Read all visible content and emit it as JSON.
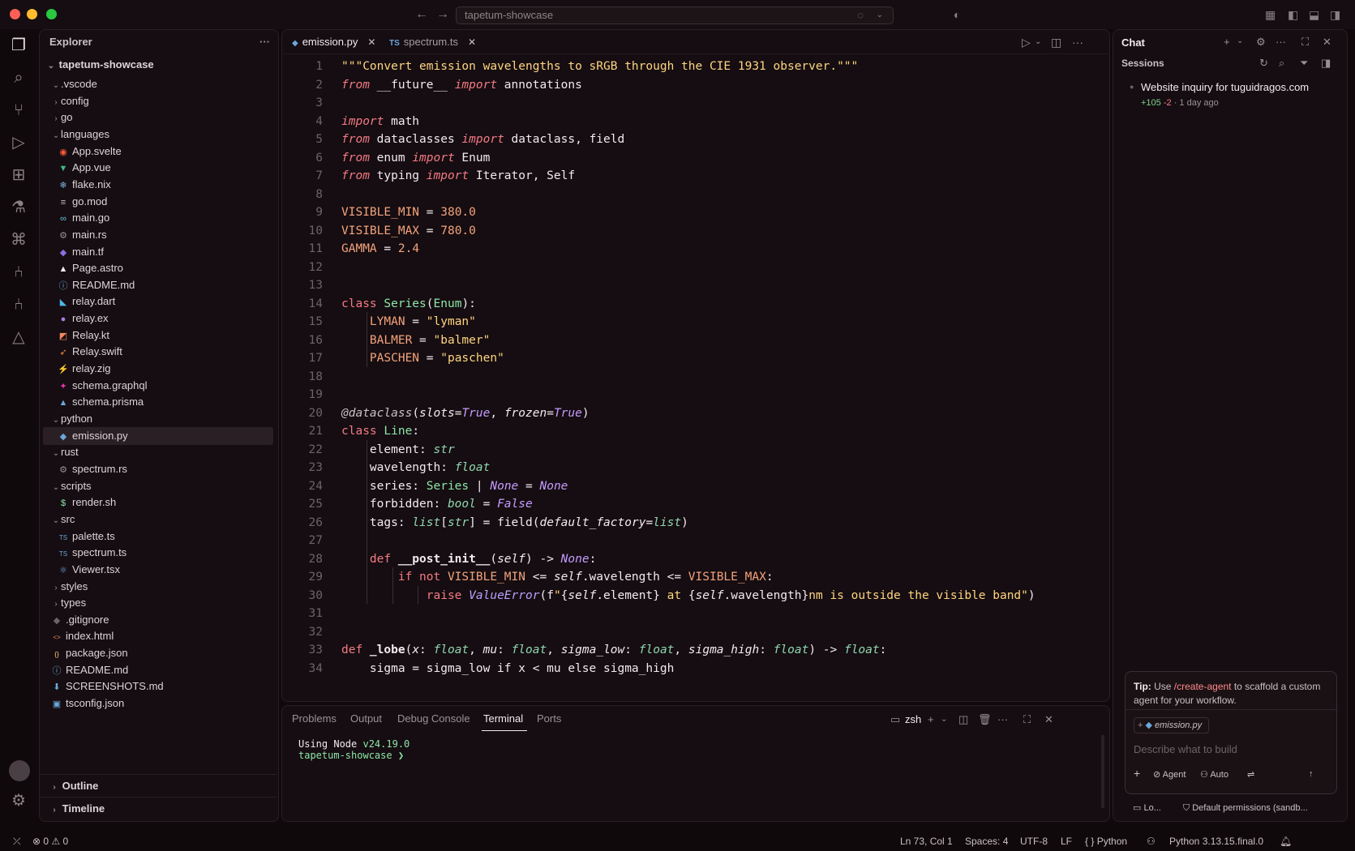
{
  "window": {
    "search_text": "tapetum-showcase"
  },
  "explorer": {
    "title": "Explorer",
    "root": "tapetum-showcase",
    "items": [
      {
        "label": ".vscode",
        "type": "folder",
        "expanded": true,
        "depth": 1
      },
      {
        "label": "config",
        "type": "folder",
        "expanded": false,
        "depth": 1
      },
      {
        "label": "go",
        "type": "folder",
        "expanded": false,
        "depth": 1
      },
      {
        "label": "languages",
        "type": "folder",
        "expanded": true,
        "depth": 1
      },
      {
        "label": "App.svelte",
        "type": "file",
        "icon": "svelte-icon",
        "depth": 2
      },
      {
        "label": "App.vue",
        "type": "file",
        "icon": "vue-icon",
        "depth": 2
      },
      {
        "label": "flake.nix",
        "type": "file",
        "icon": "nix-icon",
        "depth": 2
      },
      {
        "label": "go.mod",
        "type": "file",
        "icon": "gomod-icon",
        "depth": 2
      },
      {
        "label": "main.go",
        "type": "file",
        "icon": "go-icon",
        "depth": 2
      },
      {
        "label": "main.rs",
        "type": "file",
        "icon": "rust-icon",
        "depth": 2
      },
      {
        "label": "main.tf",
        "type": "file",
        "icon": "terraform-icon",
        "depth": 2
      },
      {
        "label": "Page.astro",
        "type": "file",
        "icon": "astro-icon",
        "depth": 2
      },
      {
        "label": "README.md",
        "type": "file",
        "icon": "info-icon",
        "depth": 2
      },
      {
        "label": "relay.dart",
        "type": "file",
        "icon": "dart-icon",
        "depth": 2
      },
      {
        "label": "relay.ex",
        "type": "file",
        "icon": "elixir-icon",
        "depth": 2
      },
      {
        "label": "Relay.kt",
        "type": "file",
        "icon": "kotlin-icon",
        "depth": 2
      },
      {
        "label": "Relay.swift",
        "type": "file",
        "icon": "swift-icon",
        "depth": 2
      },
      {
        "label": "relay.zig",
        "type": "file",
        "icon": "zig-icon",
        "depth": 2
      },
      {
        "label": "schema.graphql",
        "type": "file",
        "icon": "graphql-icon",
        "depth": 2
      },
      {
        "label": "schema.prisma",
        "type": "file",
        "icon": "prisma-icon",
        "depth": 2
      },
      {
        "label": "python",
        "type": "folder",
        "expanded": true,
        "depth": 1
      },
      {
        "label": "emission.py",
        "type": "file",
        "icon": "python-icon",
        "depth": 2,
        "selected": true
      },
      {
        "label": "rust",
        "type": "folder",
        "expanded": true,
        "depth": 1
      },
      {
        "label": "spectrum.rs",
        "type": "file",
        "icon": "rust-icon",
        "depth": 2
      },
      {
        "label": "scripts",
        "type": "folder",
        "expanded": true,
        "depth": 1
      },
      {
        "label": "render.sh",
        "type": "file",
        "icon": "shell-icon",
        "depth": 2
      },
      {
        "label": "src",
        "type": "folder",
        "expanded": true,
        "depth": 1
      },
      {
        "label": "palette.ts",
        "type": "file",
        "icon": "typescript-icon",
        "depth": 2
      },
      {
        "label": "spectrum.ts",
        "type": "file",
        "icon": "typescript-icon",
        "depth": 2
      },
      {
        "label": "Viewer.tsx",
        "type": "file",
        "icon": "react-icon",
        "depth": 2
      },
      {
        "label": "styles",
        "type": "folder",
        "expanded": false,
        "depth": 1
      },
      {
        "label": "types",
        "type": "folder",
        "expanded": false,
        "depth": 1
      },
      {
        "label": ".gitignore",
        "type": "file",
        "icon": "git-icon",
        "depth": 1
      },
      {
        "label": "index.html",
        "type": "file",
        "icon": "html-icon",
        "depth": 1
      },
      {
        "label": "package.json",
        "type": "file",
        "icon": "json-icon",
        "depth": 1
      },
      {
        "label": "README.md",
        "type": "file",
        "icon": "info-icon",
        "depth": 1
      },
      {
        "label": "SCREENSHOTS.md",
        "type": "file",
        "icon": "markdown-icon",
        "depth": 1
      },
      {
        "label": "tsconfig.json",
        "type": "file",
        "icon": "tsconfig-icon",
        "depth": 1
      }
    ],
    "outline": "Outline",
    "timeline": "Timeline"
  },
  "editor": {
    "tabs": [
      {
        "label": "emission.py",
        "icon": "python-icon",
        "active": true
      },
      {
        "label": "spectrum.ts",
        "icon": "typescript-icon",
        "icon_text": "TS",
        "active": false
      }
    ]
  },
  "code_lines": [
    [
      [
        "s",
        "\"\"\"Convert emission wavelengths to sRGB through the CIE 1931 observer.\"\"\""
      ]
    ],
    [
      [
        "k",
        "from"
      ],
      [
        "p",
        " __future__ "
      ],
      [
        "k",
        "import"
      ],
      [
        "p",
        " annotations"
      ]
    ],
    [],
    [
      [
        "k",
        "import"
      ],
      [
        "p",
        " math"
      ]
    ],
    [
      [
        "k",
        "from"
      ],
      [
        "p",
        " dataclasses "
      ],
      [
        "k",
        "import"
      ],
      [
        "p",
        " dataclass, field"
      ]
    ],
    [
      [
        "k",
        "from"
      ],
      [
        "p",
        " enum "
      ],
      [
        "k",
        "import"
      ],
      [
        "p",
        " Enum"
      ]
    ],
    [
      [
        "k",
        "from"
      ],
      [
        "p",
        " typing "
      ],
      [
        "k",
        "import"
      ],
      [
        "p",
        " Iterator, Self"
      ]
    ],
    [],
    [
      [
        "n",
        "VISIBLE_MIN"
      ],
      [
        "p",
        " = "
      ],
      [
        "n",
        "380.0"
      ]
    ],
    [
      [
        "n",
        "VISIBLE_MAX"
      ],
      [
        "p",
        " = "
      ],
      [
        "n",
        "780.0"
      ]
    ],
    [
      [
        "n",
        "GAMMA"
      ],
      [
        "p",
        " = "
      ],
      [
        "n",
        "2.4"
      ]
    ],
    [],
    [],
    [
      [
        "kn",
        "class "
      ],
      [
        "cls",
        "Series"
      ],
      [
        "p",
        "("
      ],
      [
        "cls",
        "Enum"
      ],
      [
        "p",
        "):"
      ]
    ],
    [
      [
        "p",
        "    "
      ],
      [
        "n",
        "LYMAN"
      ],
      [
        "p",
        " = "
      ],
      [
        "s",
        "\"lyman\""
      ]
    ],
    [
      [
        "p",
        "    "
      ],
      [
        "n",
        "BALMER"
      ],
      [
        "p",
        " = "
      ],
      [
        "s",
        "\"balmer\""
      ]
    ],
    [
      [
        "p",
        "    "
      ],
      [
        "n",
        "PASCHEN"
      ],
      [
        "p",
        " = "
      ],
      [
        "s",
        "\"paschen\""
      ]
    ],
    [],
    [],
    [
      [
        "dec",
        "@dataclass"
      ],
      [
        "p",
        "("
      ],
      [
        "self",
        "slots"
      ],
      [
        "p",
        "="
      ],
      [
        "bi",
        "True"
      ],
      [
        "p",
        ", "
      ],
      [
        "self",
        "frozen"
      ],
      [
        "p",
        "="
      ],
      [
        "bi",
        "True"
      ],
      [
        "p",
        ")"
      ]
    ],
    [
      [
        "kn",
        "class "
      ],
      [
        "cls",
        "Line"
      ],
      [
        "p",
        ":"
      ]
    ],
    [
      [
        "p",
        "    element: "
      ],
      [
        "t",
        "str"
      ]
    ],
    [
      [
        "p",
        "    wavelength: "
      ],
      [
        "t",
        "float"
      ]
    ],
    [
      [
        "p",
        "    series: "
      ],
      [
        "cls",
        "Series"
      ],
      [
        "p",
        " | "
      ],
      [
        "bi",
        "None"
      ],
      [
        "p",
        " = "
      ],
      [
        "bi",
        "None"
      ]
    ],
    [
      [
        "p",
        "    forbidden: "
      ],
      [
        "t",
        "bool"
      ],
      [
        "p",
        " = "
      ],
      [
        "bi",
        "False"
      ]
    ],
    [
      [
        "p",
        "    tags: "
      ],
      [
        "t",
        "list"
      ],
      [
        "p",
        "["
      ],
      [
        "t",
        "str"
      ],
      [
        "p",
        "] = field("
      ],
      [
        "self",
        "default_factory"
      ],
      [
        "p",
        "="
      ],
      [
        "t",
        "list"
      ],
      [
        "p",
        ")"
      ]
    ],
    [],
    [
      [
        "p",
        "    "
      ],
      [
        "kn",
        "def "
      ],
      [
        "fn",
        "__post_init__"
      ],
      [
        "p",
        "("
      ],
      [
        "self",
        "self"
      ],
      [
        "p",
        ") -> "
      ],
      [
        "bi",
        "None"
      ],
      [
        "p",
        ":"
      ]
    ],
    [
      [
        "p",
        "        "
      ],
      [
        "kn",
        "if not "
      ],
      [
        "n",
        "VISIBLE_MIN"
      ],
      [
        "p",
        " <= "
      ],
      [
        "self",
        "self"
      ],
      [
        "p",
        ".wavelength <= "
      ],
      [
        "n",
        "VISIBLE_MAX"
      ],
      [
        "p",
        ":"
      ]
    ],
    [
      [
        "p",
        "            "
      ],
      [
        "kn",
        "raise "
      ],
      [
        "f",
        "ValueError"
      ],
      [
        "p",
        "(f"
      ],
      [
        "s",
        "\""
      ],
      [
        "p",
        "{"
      ],
      [
        "self",
        "self"
      ],
      [
        "p",
        ".element} "
      ],
      [
        "s",
        "at "
      ],
      [
        "p",
        "{"
      ],
      [
        "self",
        "self"
      ],
      [
        "p",
        ".wavelength}"
      ],
      [
        "s",
        "nm is outside the visible band\""
      ],
      [
        "p",
        ")"
      ]
    ],
    [],
    [],
    [
      [
        "kn",
        "def "
      ],
      [
        "fn",
        "_lobe"
      ],
      [
        "p",
        "("
      ],
      [
        "self",
        "x"
      ],
      [
        "p",
        ": "
      ],
      [
        "t",
        "float"
      ],
      [
        "p",
        ", "
      ],
      [
        "self",
        "mu"
      ],
      [
        "p",
        ": "
      ],
      [
        "t",
        "float"
      ],
      [
        "p",
        ", "
      ],
      [
        "self",
        "sigma_low"
      ],
      [
        "p",
        ": "
      ],
      [
        "t",
        "float"
      ],
      [
        "p",
        ", "
      ],
      [
        "self",
        "sigma_high"
      ],
      [
        "p",
        ": "
      ],
      [
        "t",
        "float"
      ],
      [
        "p",
        ") -> "
      ],
      [
        "t",
        "float"
      ],
      [
        "p",
        ":"
      ]
    ],
    [
      [
        "p",
        "    sigma = sigma_low if x < mu else sigma_high"
      ]
    ]
  ],
  "panel": {
    "tabs": [
      "Problems",
      "Output",
      "Debug Console",
      "Terminal",
      "Ports"
    ],
    "active_tab": "Terminal",
    "shell": "zsh",
    "terminal_line1_prefix": "Using Node ",
    "terminal_line1_version": "v24.19.0",
    "terminal_line2": "tapetum-showcase ❯"
  },
  "chat": {
    "title": "Chat",
    "sessions_label": "Sessions",
    "session": {
      "title": "Website inquiry for tuguidragos.com",
      "added": "+105",
      "removed": "-2",
      "time": "· 1 day ago"
    },
    "tip": {
      "label": "Tip:",
      "text_before": " Use ",
      "command": "/create-agent",
      "text_after": " to scaffold a custom agent for your workflow."
    },
    "context_chip": "emission.py",
    "input_placeholder": "Describe what to build",
    "mode": "Agent",
    "model": "Auto",
    "footer_left": "Lo...",
    "footer_right": "Default permissions (sandb..."
  },
  "statusbar": {
    "errors": "0",
    "warnings": "0",
    "position": "Ln 73, Col 1",
    "spaces": "Spaces: 4",
    "encoding": "UTF-8",
    "eol": "LF",
    "language": "Python",
    "interpreter": "Python 3.13.15.final.0"
  },
  "colors": {
    "background": "#0f090c",
    "panel": "#150d11",
    "keyword": "#f47a85",
    "string": "#ffd580",
    "constant": "#f4a37b",
    "class": "#8ee5a8",
    "builtin": "#c79bff",
    "diff_added": "#7ed38f",
    "diff_removed": "#f47a85"
  }
}
